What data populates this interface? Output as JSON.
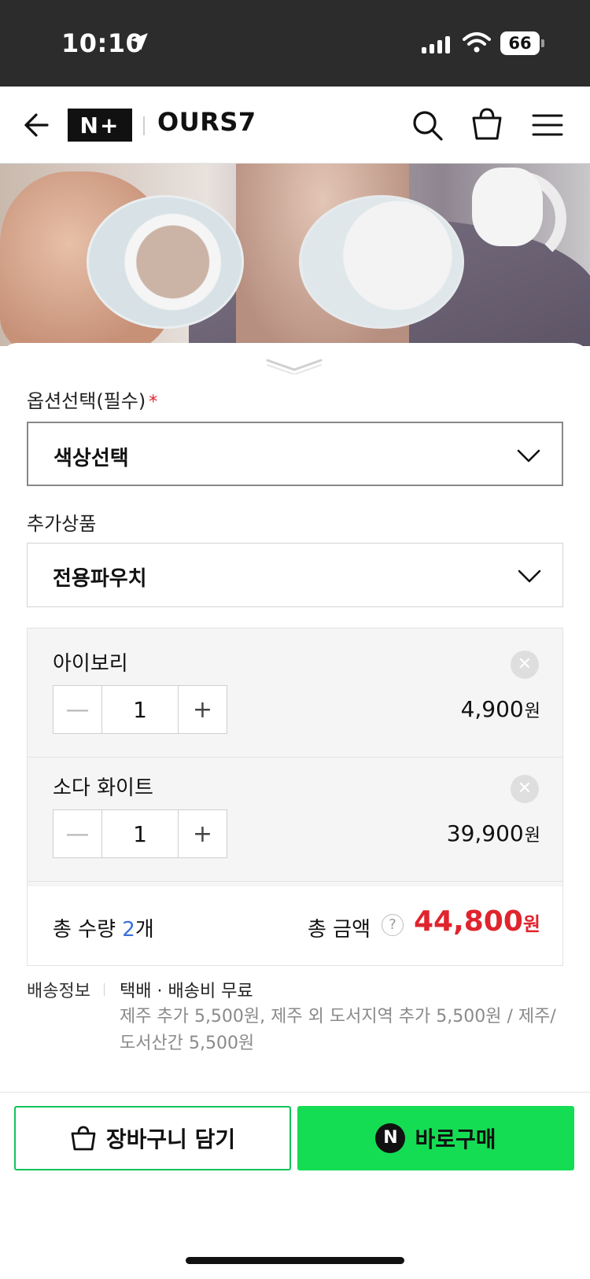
{
  "status_bar": {
    "time": "10:10",
    "battery": "66"
  },
  "header": {
    "badge": "N+",
    "brand": "OURS7"
  },
  "option_section": {
    "label": "옵션선택(필수)",
    "required_mark": "*"
  },
  "color_select": {
    "value": "색상선택"
  },
  "addon_section": {
    "label": "추가상품"
  },
  "addon_select": {
    "value": "전용파우치"
  },
  "selected_items": [
    {
      "name": "아이보리",
      "quantity": "1",
      "price": "4,900",
      "currency": "원"
    },
    {
      "name": "소다 화이트",
      "quantity": "1",
      "price": "39,900",
      "currency": "원"
    }
  ],
  "total": {
    "quantity_label": "총 수량 ",
    "quantity_count": "2",
    "quantity_unit": "개",
    "amount_label": "총 금액",
    "help": "?",
    "amount": "44,800",
    "currency": "원"
  },
  "shipping": {
    "label": "배송정보",
    "main": "택배 · 배송비 무료",
    "detail": "제주 추가 5,500원, 제주 외 도서지역 추가 5,500원 / 제주/도서산간 5,500원"
  },
  "actions": {
    "cart": "장바구니 담기",
    "buy_badge": "N",
    "buy": "바로구매"
  },
  "colors": {
    "accent_green": "#14dd54",
    "price_red": "#e0242d",
    "count_blue": "#3a6fd8"
  }
}
